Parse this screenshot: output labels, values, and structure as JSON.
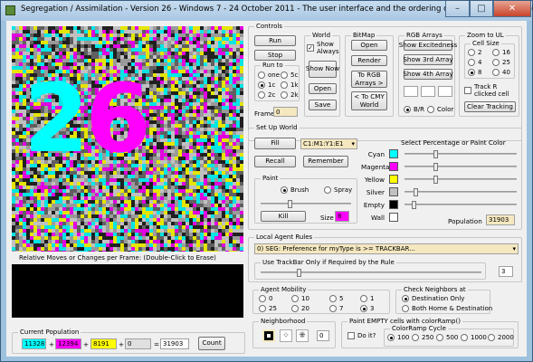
{
  "window": {
    "title": "Segregation / Assimilation - Version 26 - Windows 7 - 24 October 2011 - The user interface and the ordering of rules has been simplified...",
    "min": "–",
    "max": "□",
    "close": "✕"
  },
  "canvas": {
    "number": "26",
    "moves_label": "Relative Moves or Changes per Frame:  (Double-Click to Erase)"
  },
  "population": {
    "title": "Current Population",
    "cyan": "11328",
    "magenta": "12394",
    "yellow": "8191",
    "empty": "0",
    "total": "31903",
    "plus": "+",
    "equals": "=",
    "count_label": "Count"
  },
  "controls": {
    "title": "Controls",
    "run": "Run",
    "stop": "Stop",
    "run_to": "Run to",
    "run_opts": [
      "one",
      "5c",
      "1c",
      "1k",
      "2c",
      "2k"
    ],
    "frame_label": "Frame",
    "frame_value": "0"
  },
  "world": {
    "title": "World",
    "show_always": "Show Always",
    "show_now": "Show Now",
    "open": "Open",
    "save": "Save"
  },
  "bitmap": {
    "title": "BitMap",
    "open": "Open",
    "render": "Render",
    "to_rgb": "To RGB Arrays >",
    "to_cmy": "< To CMY World"
  },
  "rgb": {
    "title": "RGB Arrays",
    "excitedness": "Show Excitedness",
    "third": "Show 3rd Array",
    "fourth": "Show 4th Array",
    "br": "B/R",
    "color": "Color"
  },
  "zoom": {
    "title": "Zoom to UL",
    "cell_size": "Cell Size",
    "sizes": [
      "2",
      "16",
      "4",
      "25",
      "8",
      "40"
    ],
    "track_r": "Track R clicked cell",
    "clear": "Clear Tracking"
  },
  "setup": {
    "title": "Set Up World",
    "fill": "Fill",
    "range": "C1:M1:Y1:E1",
    "recall": "Recall",
    "remember": "Remember",
    "select_label": "Select Percentage or Paint Color"
  },
  "paint": {
    "title": "Paint",
    "brush": "Brush",
    "spray": "Spray",
    "kill": "Kill",
    "size_label": "Size",
    "size_value": "8"
  },
  "colors": {
    "cyan": "Cyan",
    "magenta": "Magenta",
    "yellow": "Yellow",
    "silver": "Silver",
    "empty": "Empty",
    "wall": "Wall",
    "pop_label": "Population",
    "pop_value": "31903",
    "hex": {
      "cyan": "#00ffff",
      "magenta": "#ff00ff",
      "yellow": "#ffff00",
      "silver": "#c0c0c0",
      "empty": "#000000",
      "wall": "#ffffff"
    }
  },
  "rules": {
    "title": "Local Agent Rules",
    "selected": "0) SEG: Preference for myType is >= TRACKBAR...",
    "trackbar_title": "Use TrackBar Only if Required by the Rule",
    "trackbar_value": "3"
  },
  "mobility": {
    "title": "Agent Mobility",
    "opts": [
      "0",
      "10",
      "5",
      "1",
      "25",
      "20",
      "7",
      "3"
    ]
  },
  "neighbors": {
    "title": "Check Neighbors at",
    "dest": "Destination Only",
    "both": "Both Home & Destination"
  },
  "neighborhood": {
    "title": "Neighborhood",
    "value": "0"
  },
  "paint_empty": {
    "title": "Paint EMPTY cells with colorRamp()",
    "do_it": "Do it?",
    "ramp_title": "ColorRamp Cycle",
    "ramps": [
      "100",
      "250",
      "500",
      "1000",
      "2000"
    ]
  }
}
